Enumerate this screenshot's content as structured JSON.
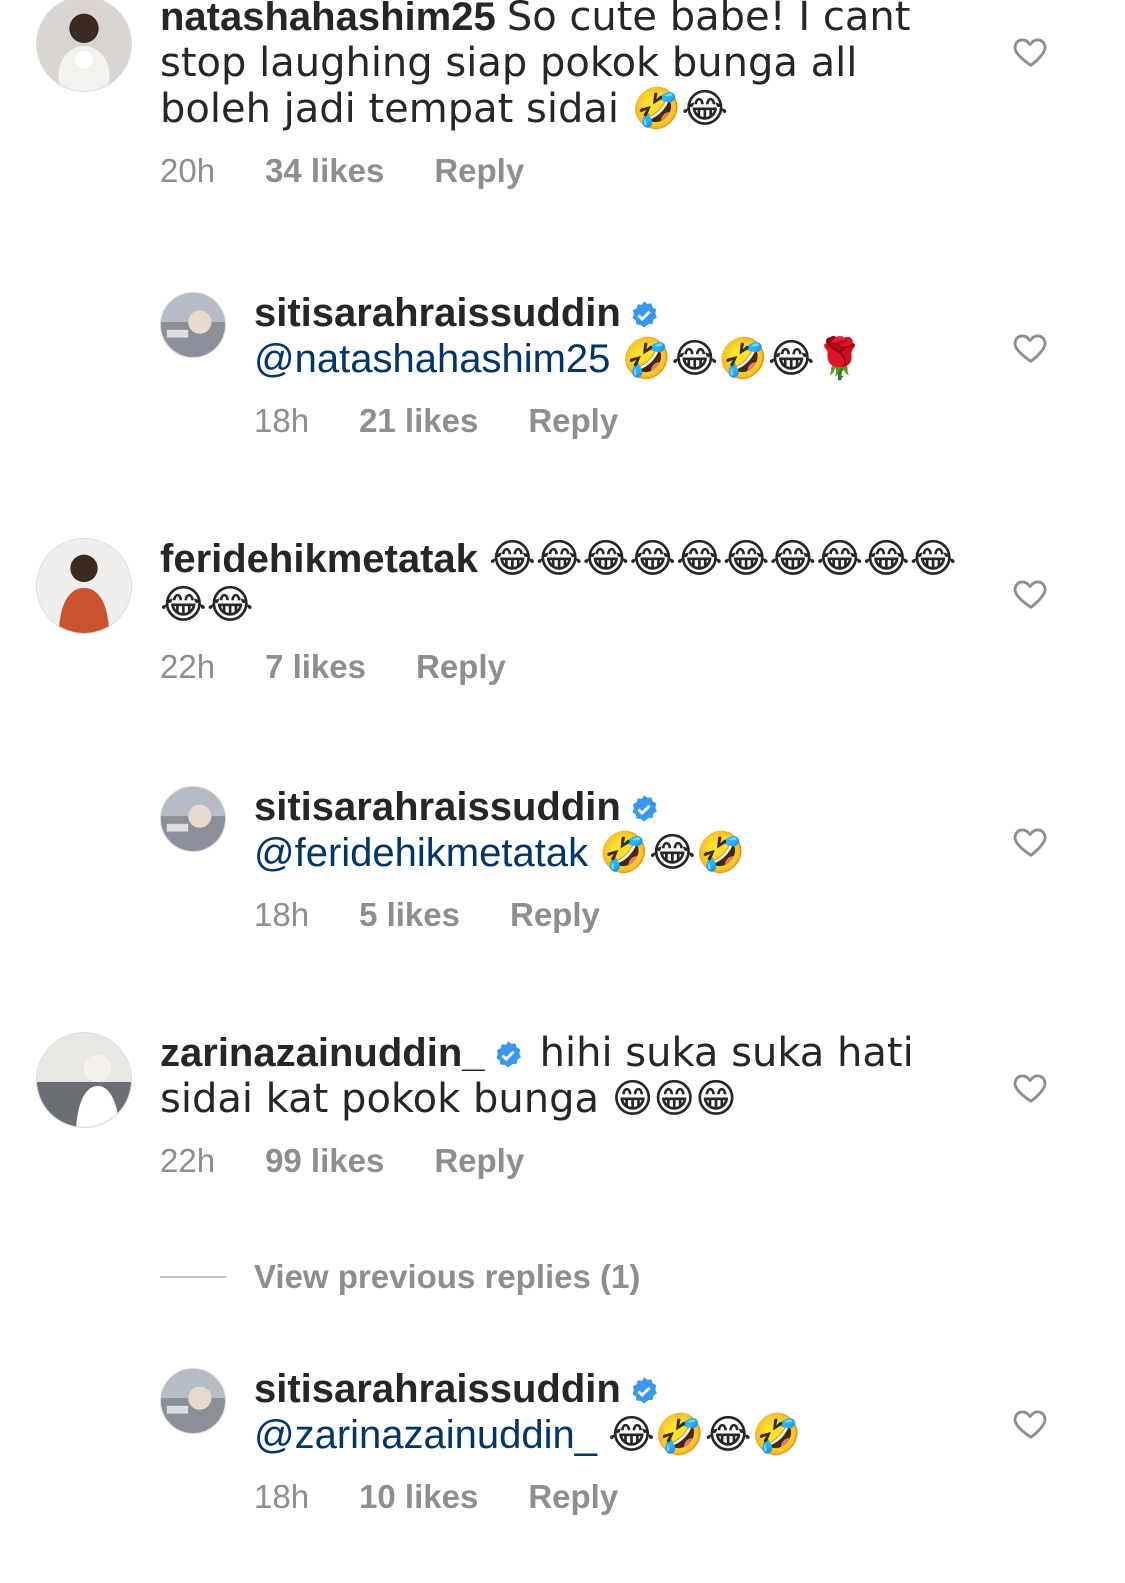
{
  "comments": [
    {
      "username": "natashahashim25",
      "verified": false,
      "text": "So cute babe! I cant stop laughing siap pokok bunga all boleh jadi tempat sidai 🤣😂",
      "time": "20h",
      "likes": "34 likes",
      "reply_label": "Reply"
    },
    {
      "username": "sitisarahraissuddin",
      "verified": true,
      "mention": "@natashahashim25",
      "text": "🤣😂🤣😂🌹",
      "time": "18h",
      "likes": "21 likes",
      "reply_label": "Reply"
    },
    {
      "username": "ferideh ikmetatak",
      "verified": false,
      "text": "😂😂😂😂😂😂😂😂😂😂😂😂",
      "time": "22h",
      "likes": "7 likes",
      "reply_label": "Reply"
    },
    {
      "username": "sitisarahraissuddin",
      "verified": true,
      "mention": "@feridehikmetatak",
      "text": "🤣😂🤣",
      "time": "18h",
      "likes": "5 likes",
      "reply_label": "Reply"
    },
    {
      "username": "zarinazainuddin_",
      "verified": true,
      "text": "hihi suka suka hati sidai kat pokok bunga 😁😁😁",
      "time": "22h",
      "likes": "99 likes",
      "reply_label": "Reply"
    },
    {
      "username": "sitisarahraissuddin",
      "verified": true,
      "mention": "@zarinazainuddin_",
      "text": "😂🤣😂🤣",
      "time": "18h",
      "likes": "10 likes",
      "reply_label": "Reply"
    }
  ],
  "view_previous": "View previous replies (1)",
  "colors": {
    "text": "#262626",
    "meta": "#8e8e8e",
    "mention": "#003569",
    "verified": "#3897f0"
  }
}
